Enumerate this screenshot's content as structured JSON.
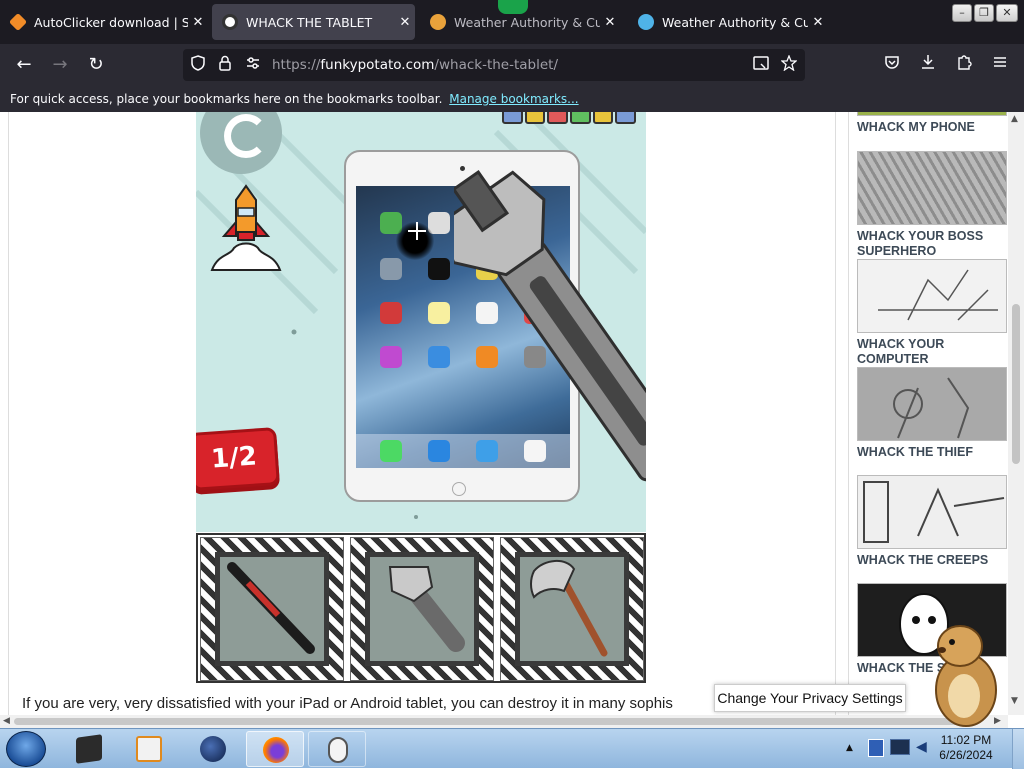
{
  "browser": {
    "tabs": [
      {
        "title": "AutoClicker download | Sour",
        "active": false,
        "favicon_color": "#f28c28"
      },
      {
        "title": "WHACK THE TABLET",
        "active": true,
        "favicon_color": "#ffffff"
      },
      {
        "title": "Weather Authority & Custom",
        "active": false,
        "favicon_color": "#e9a23b"
      },
      {
        "title": "Weather Authority & Custom",
        "active": false,
        "favicon_color": "#4fb3e8"
      }
    ],
    "close_glyph": "✕",
    "window_controls": {
      "minimize": "–",
      "maximize": "❐",
      "close": "✕"
    },
    "nav": {
      "back": "←",
      "forward": "→",
      "reload": "↻"
    },
    "url": {
      "scheme": "https://",
      "domain": "funkypotato.com",
      "path": "/whack-the-tablet/"
    },
    "bookmarks_bar": {
      "message": "For quick access, place your bookmarks here on the bookmarks toolbar.",
      "link": "Manage bookmarks..."
    },
    "toolbar_icons": [
      "reader-view-icon",
      "bookmark-star-icon",
      "pocket-icon",
      "downloads-icon",
      "extensions-icon",
      "menu-icon"
    ]
  },
  "game": {
    "level": "1/2",
    "tools": [
      "baseball-bat",
      "wrench",
      "axe"
    ],
    "selected_tool": "wrench",
    "accent": "#d8232a",
    "background": "#cbe9e6"
  },
  "article": {
    "text": "If you are very, very dissatisfied with your iPad or Android tablet, you can destroy it in many sophis"
  },
  "sidebar": {
    "items": [
      {
        "label": "WHACK MY PHONE"
      },
      {
        "label": "WHACK YOUR BOSS SUPERHERO"
      },
      {
        "label": "WHACK YOUR COMPUTER"
      },
      {
        "label": "WHACK THE THIEF"
      },
      {
        "label": "WHACK THE CREEPS"
      },
      {
        "label": "WHACK THE S"
      }
    ]
  },
  "privacy": {
    "label": "Change Your Privacy Settings"
  },
  "taskbar": {
    "apps": [
      "media-center",
      "media-player",
      "browser-globe",
      "firefox",
      "mouse-autoclicker"
    ],
    "active_app": "firefox",
    "clock": {
      "time": "11:02 PM",
      "date": "6/26/2024"
    }
  }
}
